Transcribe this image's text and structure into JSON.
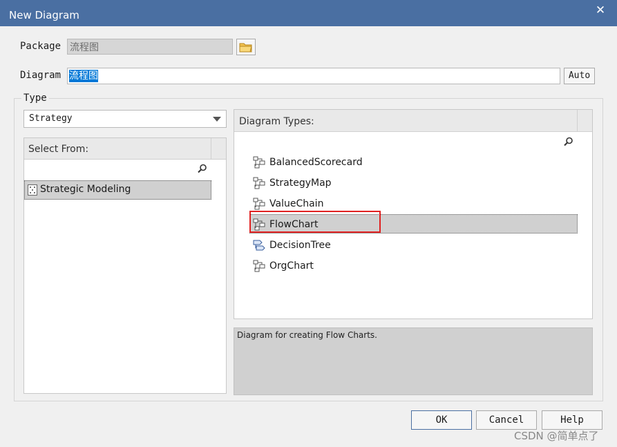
{
  "window": {
    "title": "New Diagram"
  },
  "form": {
    "package_label": "Package",
    "package_value": "流程图",
    "diagram_label": "Diagram",
    "diagram_value": "流程图",
    "auto_label": "Auto"
  },
  "type_group": {
    "label": "Type",
    "selected": "Strategy",
    "select_from_header": "Select From:",
    "select_from_items": [
      "Strategic Modeling"
    ],
    "diagram_types_header": "Diagram Types:",
    "diagram_types": [
      "BalancedScorecard",
      "StrategyMap",
      "ValueChain",
      "FlowChart",
      "DecisionTree",
      "OrgChart"
    ],
    "selected_type": "FlowChart",
    "description": "Diagram for creating Flow Charts."
  },
  "buttons": {
    "ok": "OK",
    "cancel": "Cancel",
    "help": "Help"
  },
  "watermark": "CSDN @简单点了",
  "colors": {
    "titlebar": "#4a6fa2",
    "selection": "#d0d0d0",
    "highlight_box": "#e02020",
    "text_select": "#0078d7"
  }
}
